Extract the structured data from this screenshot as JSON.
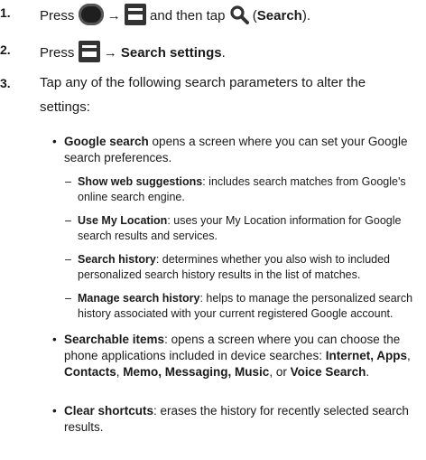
{
  "steps": [
    {
      "num": "1.",
      "pre": "Press",
      "arrow": "→",
      "mid": "and then tap",
      "search_paren_open": "(",
      "search_label": "Search",
      "search_paren_close": ")."
    },
    {
      "num": "2.",
      "pre": "Press",
      "arrow": "→",
      "label": "Search settings",
      "end": "."
    },
    {
      "num": "3.",
      "line1": "Tap any of the following search parameters to alter the",
      "line2": "settings:"
    }
  ],
  "bullets": [
    {
      "title": "Google search",
      "text": " opens a screen where you can set your Google search preferences."
    },
    {
      "title": "Searchable items",
      "text1": ": opens a screen where you can choose the phone applications included in device searches: ",
      "i1": "Internet, Apps",
      "c1": ", ",
      "i2": "Contacts",
      "c2": ", ",
      "i3": "Memo, Messaging, Music",
      "c3": ", or ",
      "i4": "Voice Search",
      "c4": "."
    },
    {
      "title": "Clear shortcuts",
      "text": ": erases the history for recently selected search results."
    }
  ],
  "subs": [
    {
      "title": "Show web suggestions",
      "text": ": includes search matches from Google's online search engine."
    },
    {
      "title": "Use My Location",
      "text": ": uses your My Location information for Google search results and services."
    },
    {
      "title": "Search history",
      "text": ": determines whether you also wish to included personalized search history results in the list of matches."
    },
    {
      "title": "Manage search history",
      "text": ": helps to manage the personalized search history associated with your current registered Google account."
    }
  ],
  "icons": {
    "home": "home-key-icon",
    "menu": "menu-key-icon",
    "search": "search-icon"
  },
  "bullet_char": "•",
  "dash_char": "–"
}
